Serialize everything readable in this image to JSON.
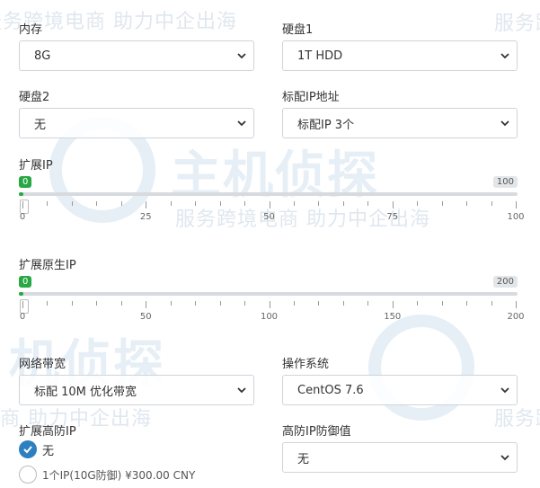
{
  "watermark": {
    "slogan": "服务跨境电商 助力中企出海",
    "slogan_short": "服务跨",
    "slogan_left": "商 助力中企出海",
    "brand": "主机侦探",
    "brand_partial": "机侦探"
  },
  "fields": {
    "memory": {
      "label": "内存",
      "value": "8G"
    },
    "disk1": {
      "label": "硬盘1",
      "value": "1T HDD"
    },
    "disk2": {
      "label": "硬盘2",
      "value": "无"
    },
    "std_ip": {
      "label": "标配IP地址",
      "value": "标配IP 3个"
    },
    "bandwidth": {
      "label": "网络带宽",
      "value": "标配 10M 优化带宽"
    },
    "os": {
      "label": "操作系统",
      "value": "CentOS 7.6"
    },
    "ddos_value": {
      "label": "高防IP防御值",
      "value": "无"
    }
  },
  "slider_ip": {
    "label": "扩展IP",
    "min_label": "0",
    "max_label": "100",
    "value": 0,
    "ticks": [
      "0",
      "25",
      "50",
      "75",
      "100"
    ]
  },
  "slider_native_ip": {
    "label": "扩展原生IP",
    "min_label": "0",
    "max_label": "200",
    "value": 0,
    "ticks": [
      "0",
      "50",
      "100",
      "150",
      "200"
    ]
  },
  "ddos_ip": {
    "label": "扩展高防IP",
    "options": [
      {
        "label": "无",
        "selected": true
      },
      {
        "label": "1个IP(10G防御) ¥300.00 CNY",
        "selected": false
      }
    ]
  },
  "colors": {
    "accent": "#2e7fc0",
    "slider_fill": "#28a745"
  }
}
